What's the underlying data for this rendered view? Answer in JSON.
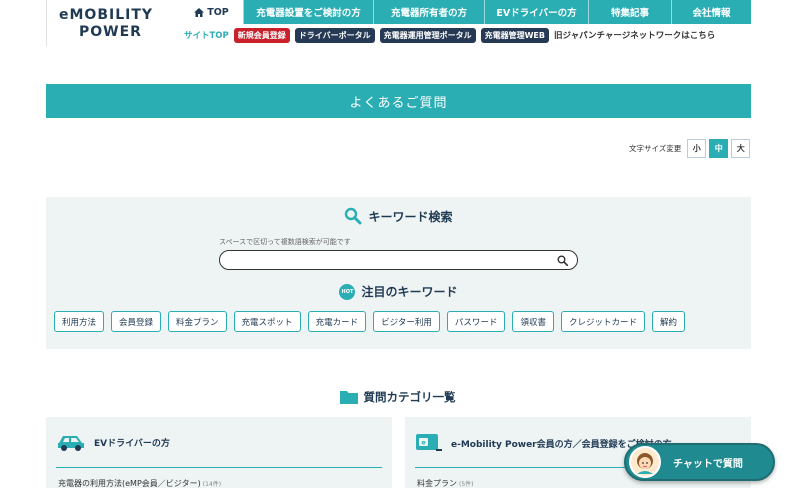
{
  "brand": {
    "logo_line1": "eMOBILITY",
    "logo_line2": "POWER",
    "accent_color": "#2aaeb4",
    "navy_color": "#1f3a52"
  },
  "topnav": {
    "items": [
      {
        "label": "TOP",
        "icon": "home-icon"
      },
      {
        "label": "充電器設置をご検討の方"
      },
      {
        "label": "充電器所有者の方"
      },
      {
        "label": "EVドライバーの方"
      },
      {
        "label": "特集記事"
      },
      {
        "label": "会社情報"
      }
    ]
  },
  "subnav": {
    "site_top": "サイトTOP",
    "register": "新規会員登録",
    "driver_portal": "ドライバーポータル",
    "operator_portal": "充電器運用管理ポータル",
    "charger_web": "充電器管理WEB",
    "old_network": "旧ジャパンチャージネットワークはこちら"
  },
  "page": {
    "title": "よくあるご質問"
  },
  "font_size": {
    "label": "文字サイズ変更",
    "small": "小",
    "medium": "中",
    "large": "大",
    "selected": "中"
  },
  "search": {
    "heading": "キーワード検索",
    "hint": "スペースで区切って複数語検索が可能です",
    "value": "",
    "placeholder": ""
  },
  "hot_keywords": {
    "badge": "HOT",
    "heading": "注目のキーワード",
    "tags": [
      "利用方法",
      "会員登録",
      "料金プラン",
      "充電スポット",
      "充電カード",
      "ビジター利用",
      "パスワード",
      "領収書",
      "クレジットカード",
      "解約"
    ]
  },
  "categories": {
    "heading": "質問カテゴリ一覧",
    "cards": [
      {
        "title": "EVドライバーの方",
        "icon": "car-icon",
        "first_item": "充電器の利用方法(eMP会員／ビジター)",
        "first_item_count": "(14件)"
      },
      {
        "title": "e-Mobility Power会員の方／会員登録をご検討の方",
        "icon": "member-card-icon",
        "first_item": "料金プラン",
        "first_item_count": "(5件)"
      }
    ]
  },
  "chat": {
    "label": "チャットで質問"
  }
}
